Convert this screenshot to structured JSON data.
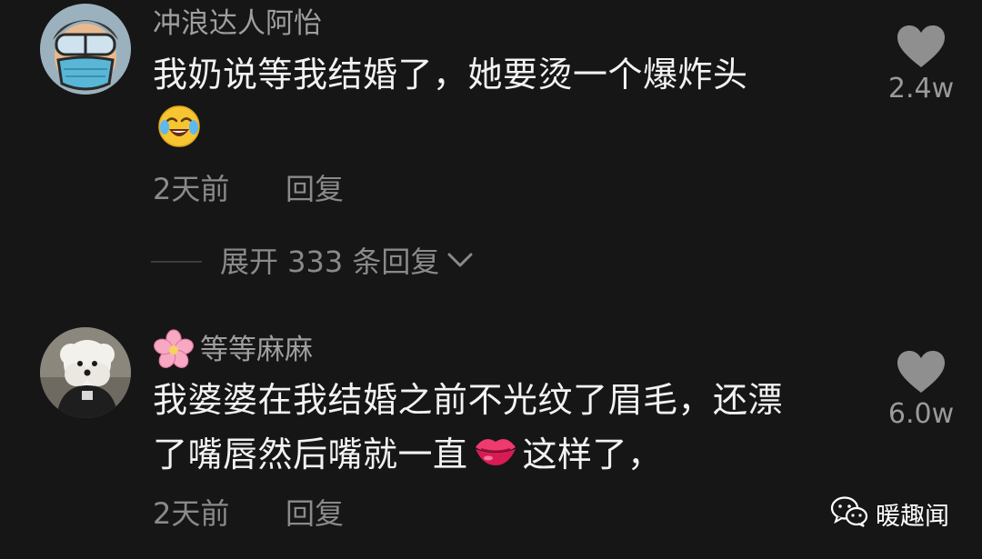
{
  "comments": [
    {
      "username": "冲浪达人阿怡",
      "text_lines": [
        "我奶说等我结婚了，她要烫一个爆炸头"
      ],
      "emoji": "crying-laughing-emoji",
      "time": "2天前",
      "reply_label": "回复",
      "like_count": "2.4w",
      "like_icon": "heart-icon"
    },
    {
      "username_prefix_emoji": "cherry-blossom-emoji",
      "username": "等等麻麻",
      "text_lines": [
        "我婆婆在我结婚之前不光纹了眉毛，还漂",
        "了嘴唇然后嘴就一直"
      ],
      "text_after_emoji": "这样了，",
      "emoji": "kiss-lips-emoji",
      "time": "2天前",
      "reply_label": "回复",
      "like_count": "6.0w",
      "like_icon": "heart-icon"
    }
  ],
  "expand_replies": {
    "label": "展开 333 条回复",
    "icon": "chevron-down-icon"
  },
  "watermark": {
    "icon": "wechat-icon",
    "text": "暖趣闻"
  },
  "colors": {
    "background": "#161616",
    "primary_text": "#f2f2f2",
    "secondary_text": "#8a8a8a",
    "heart": "#8f8f8f"
  }
}
